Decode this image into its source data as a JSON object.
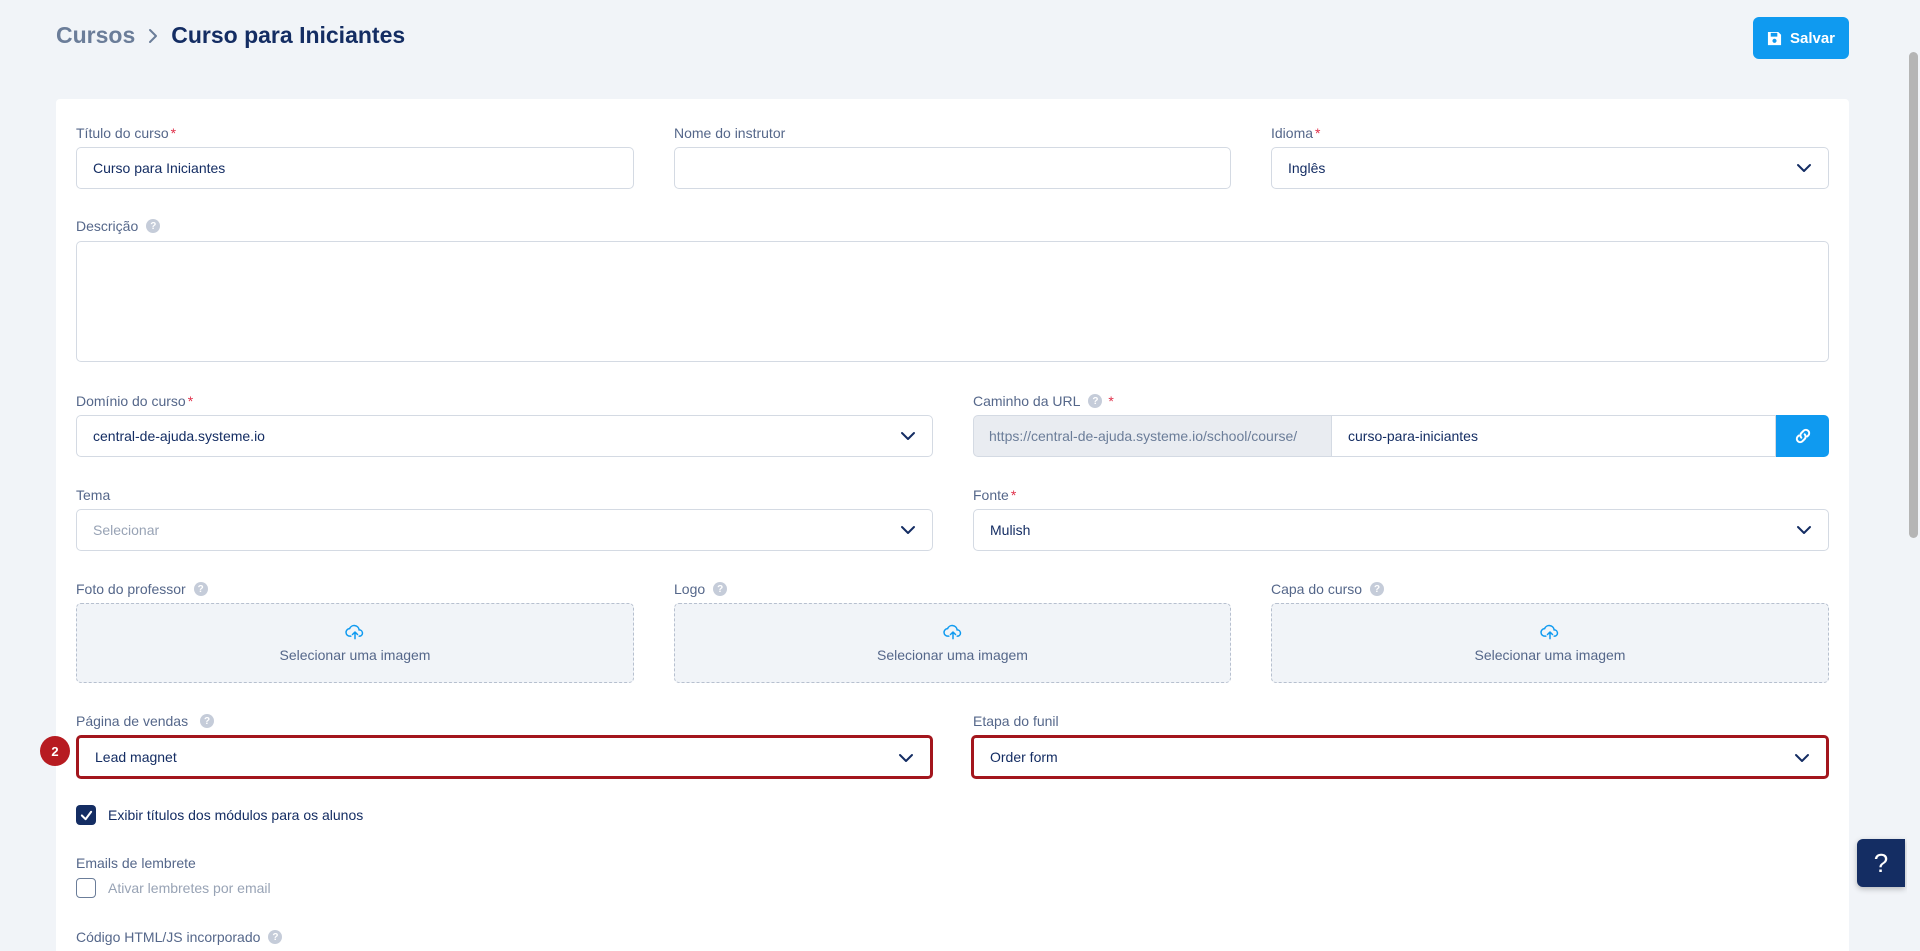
{
  "breadcrumb": {
    "root": "Cursos",
    "current": "Curso para Iniciantes"
  },
  "toolbar": {
    "save_label": "Salvar"
  },
  "form": {
    "title": {
      "label": "Título do curso",
      "value": "Curso para Iniciantes"
    },
    "instructor": {
      "label": "Nome do instrutor",
      "value": ""
    },
    "language": {
      "label": "Idioma",
      "value": "Inglês"
    },
    "description": {
      "label": "Descrição",
      "value": ""
    },
    "domain": {
      "label": "Domínio do curso",
      "value": "central-de-ajuda.systeme.io"
    },
    "url_path": {
      "label": "Caminho da URL",
      "prefix": "https://central-de-ajuda.systeme.io/school/course/",
      "slug": "curso-para-iniciantes"
    },
    "theme": {
      "label": "Tema",
      "placeholder": "Selecionar"
    },
    "font": {
      "label": "Fonte",
      "value": "Mulish"
    },
    "teacher_photo": {
      "label": "Foto do professor",
      "button": "Selecionar uma imagem"
    },
    "logo": {
      "label": "Logo",
      "button": "Selecionar uma imagem"
    },
    "cover": {
      "label": "Capa do curso",
      "button": "Selecionar uma imagem"
    },
    "sales_page": {
      "label": "Página de vendas",
      "value": "Lead magnet"
    },
    "funnel_step": {
      "label": "Etapa do funil",
      "value": "Order form"
    },
    "show_module_titles": {
      "label": "Exibir títulos dos módulos para os alunos",
      "checked": true
    },
    "reminder_emails": {
      "section": "Emails de lembrete",
      "label": "Ativar lembretes por email",
      "checked": false
    },
    "embed_code": {
      "label": "Código HTML/JS incorporado"
    }
  },
  "annotation": {
    "step": "2"
  },
  "help_fab": "?",
  "colors": {
    "accent": "#0f9af0",
    "navy": "#142d63",
    "highlight": "#a3161d"
  }
}
